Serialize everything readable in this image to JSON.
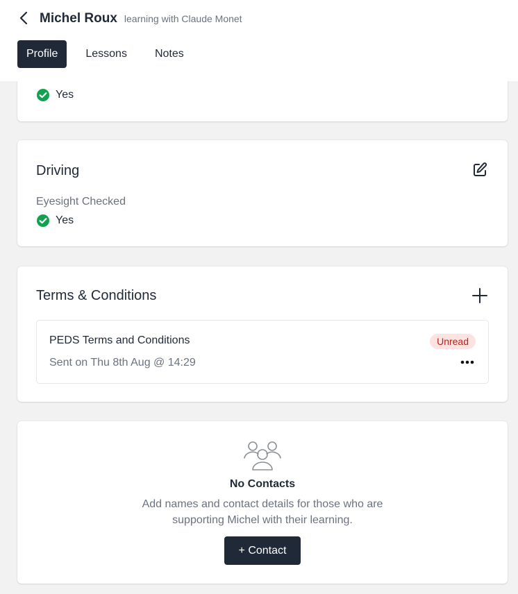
{
  "header": {
    "title": "Michel Roux",
    "subtitle": "learning with Claude Monet",
    "tabs": [
      {
        "label": "Profile",
        "active": true
      },
      {
        "label": "Lessons",
        "active": false
      },
      {
        "label": "Notes",
        "active": false
      }
    ]
  },
  "top_card": {
    "value": "Yes"
  },
  "driving": {
    "title": "Driving",
    "field_label": "Eyesight Checked",
    "field_value": "Yes"
  },
  "terms": {
    "title": "Terms & Conditions",
    "item": {
      "name": "PEDS Terms and Conditions",
      "sent": "Sent on Thu 8th Aug @ 14:29",
      "status": "Unread"
    }
  },
  "contacts": {
    "empty_title": "No Contacts",
    "empty_desc": "Add names and contact details for those who are supporting Michel with their learning.",
    "button_label": "+ Contact"
  },
  "colors": {
    "primary_dark": "#1f2937",
    "check_green": "#12a150",
    "badge_bg": "#fde2e2",
    "badge_text": "#b42318"
  },
  "icons": {
    "back": "chevron-left-icon",
    "check": "check-circle-icon",
    "edit": "edit-icon",
    "add": "plus-icon",
    "more": "more-horizontal-icon",
    "contacts": "users-icon"
  }
}
